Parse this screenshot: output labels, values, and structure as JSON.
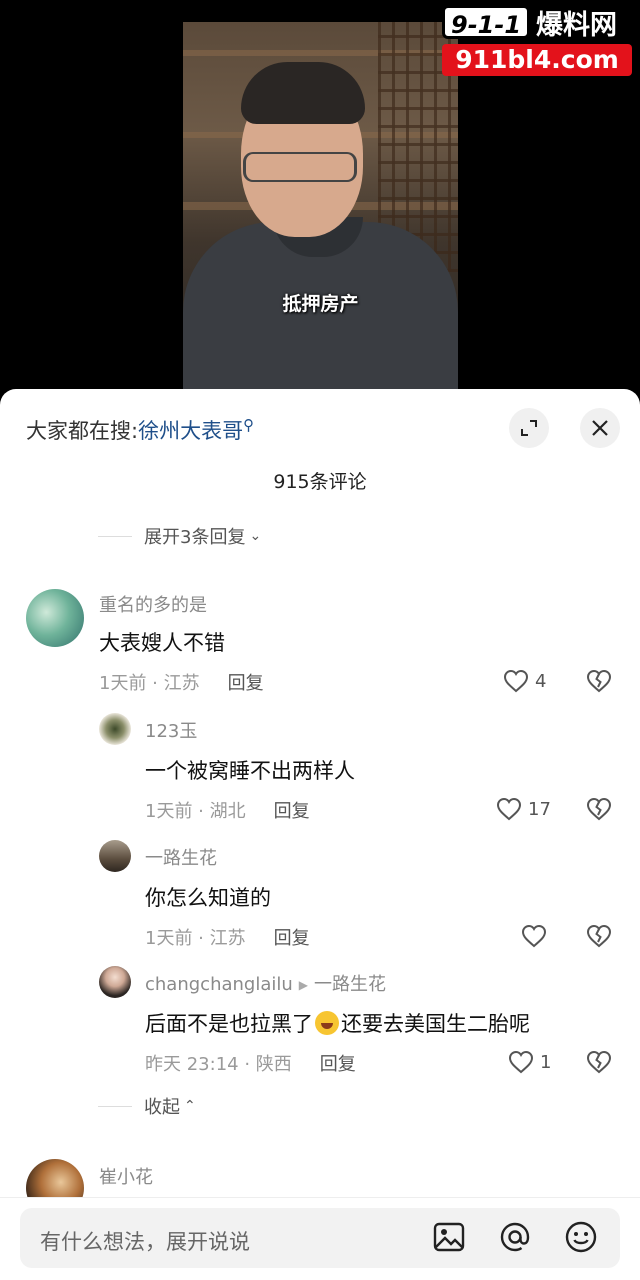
{
  "video": {
    "subtitle": "抵押房产"
  },
  "watermark": {
    "number": "9-1-1",
    "name": "爆料网",
    "url": "911bl4.com",
    "url_bg": "#e3121b"
  },
  "header": {
    "search_prefix": "大家都在搜:",
    "search_keyword": "徐州大表哥",
    "expand_icon": "expand-icon",
    "close_icon": "close-icon"
  },
  "comment_count_label": "915条评论",
  "expand_replies_label": "展开3条回复",
  "collapse_label": "收起",
  "comments": [
    {
      "user": "重名的多的是",
      "text": "大表嫂人不错",
      "time_location": "1天前 · 江苏",
      "reply_label": "回复",
      "likes": "4"
    },
    {
      "user": "123玉",
      "text": "一个被窝睡不出两样人",
      "time_location": "1天前 · 湖北",
      "reply_label": "回复",
      "likes": "17"
    },
    {
      "user": "一路生花",
      "text": "你怎么知道的",
      "time_location": "1天前 · 江苏",
      "reply_label": "回复",
      "likes": ""
    },
    {
      "user": "changchanglailu",
      "reply_to": "一路生花",
      "text_before_emoji": "后面不是也拉黑了",
      "text_after_emoji": "还要去美国生二胎呢",
      "time_location": "昨天 23:14 · 陕西",
      "reply_label": "回复",
      "likes": "1"
    },
    {
      "user": "崔小花"
    }
  ],
  "input": {
    "placeholder": "有什么想法，展开说说",
    "icons": [
      "image-icon",
      "at-icon",
      "emoji-icon"
    ]
  },
  "colors": {
    "keyword": "#1f4f8a",
    "muted_text": "#8a8a8a",
    "sheet_bg": "#ffffff"
  }
}
